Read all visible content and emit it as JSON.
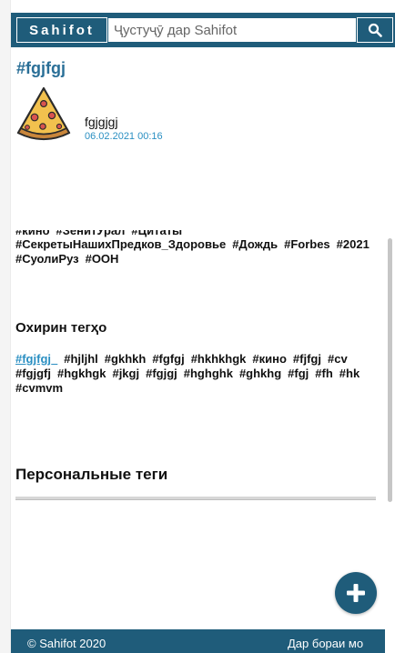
{
  "header": {
    "logo": "Sahifot",
    "search_placeholder": "Ҷустуҷӯ дар Sahifot",
    "search_icon": "magnifier-icon"
  },
  "page": {
    "title": "#fgjfgj"
  },
  "post": {
    "avatar_icon": "pizza-icon",
    "name": "fgjgjgj",
    "date": "06.02.2021 00:16"
  },
  "popular_tags": {
    "line1": [
      "#кино",
      "#ЗенитУрал",
      "#Цитаты"
    ],
    "line2": [
      "#СекретыНашихПредков_Здоровье",
      "#Дождь",
      "#Forbes",
      "#2021"
    ],
    "line3": [
      "#СуолиРуз",
      "#ООН"
    ]
  },
  "recent": {
    "title": "Охирин тегҳо",
    "line1": [
      "#fgjfgj_",
      "#hjljhl",
      "#gkhkh",
      "#fgfgj",
      "#hkhkhgk",
      "#кино",
      "#fjfgj",
      "#cv"
    ],
    "line2": [
      "#fgjgfj",
      "#hgkhgk",
      "#jkgj",
      "#fgjgj",
      "#hghghk",
      "#ghkhg",
      "#fgj",
      "#fh",
      "#hk"
    ],
    "line3": [
      "#cvmvm"
    ]
  },
  "personal": {
    "title": "Персональные теги"
  },
  "fab": {
    "icon": "plus-icon"
  },
  "footer": {
    "copyright": "© Sahifot 2020",
    "about": "Дар бораи мо"
  },
  "colors": {
    "brand": "#1f5c7a",
    "title": "#2a6f97",
    "link": "#2a8fc2"
  }
}
